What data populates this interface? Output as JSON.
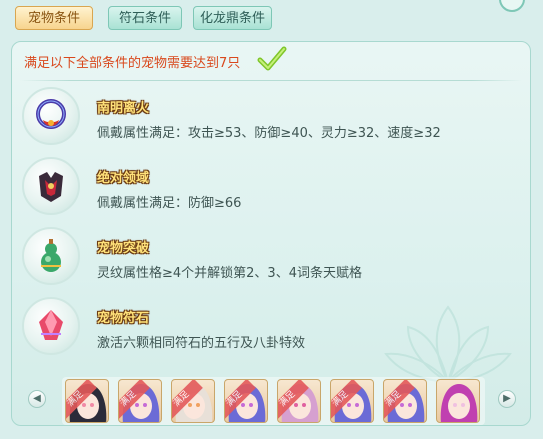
{
  "tabs": [
    {
      "label": "宠物条件",
      "active": true
    },
    {
      "label": "符石条件",
      "active": false
    },
    {
      "label": "化龙鼎条件",
      "active": false
    }
  ],
  "header": {
    "text": "满足以下全部条件的宠物需要达到7只"
  },
  "conditions": [
    {
      "title": "南明离火",
      "desc": "佩戴属性满足：攻击≥53、防御≥40、灵力≥32、速度≥32",
      "icon": "fire-pendant-icon"
    },
    {
      "title": "绝对领域",
      "desc": "佩戴属性满足：防御≥66",
      "icon": "armor-icon"
    },
    {
      "title": "宠物突破",
      "desc": "灵纹属性格≥4个并解锁第2、3、4词条天赋格",
      "icon": "gourd-icon"
    },
    {
      "title": "宠物符石",
      "desc": "激活六颗相同符石的五行及八卦特效",
      "icon": "rune-stone-icon"
    }
  ],
  "pets": [
    {
      "badge": "满足",
      "hair": "#2b2b3a",
      "accent": "#f08aa6"
    },
    {
      "badge": "满足",
      "hair": "#6b6bd6",
      "accent": "#c66bd6"
    },
    {
      "badge": "满足",
      "hair": "#e8e0d8",
      "accent": "#f0a060"
    },
    {
      "badge": "满足",
      "hair": "#6b6bd6",
      "accent": "#c66bd6"
    },
    {
      "badge": "满足",
      "hair": "#d6a0d0",
      "accent": "#e060a0"
    },
    {
      "badge": "满足",
      "hair": "#6b6bd6",
      "accent": "#c66bd6"
    },
    {
      "badge": "满足",
      "hair": "#6b6bd6",
      "accent": "#c66bd6"
    },
    {
      "badge": "",
      "hair": "#c040b0",
      "accent": "#f0c0e0"
    }
  ],
  "colors": {
    "header_text": "#d9481c",
    "check": "#7fc62a",
    "badge": "#e4595a"
  }
}
